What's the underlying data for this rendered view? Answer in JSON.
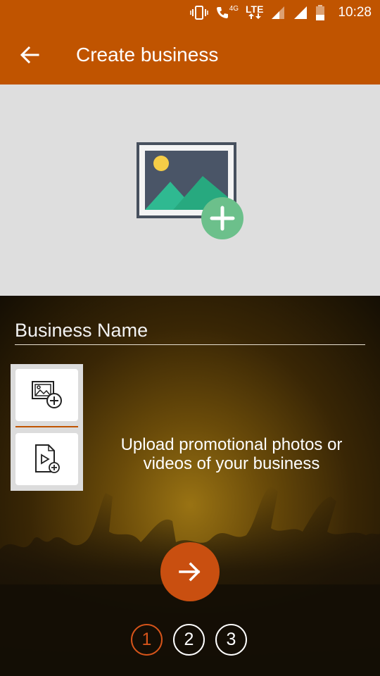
{
  "status_bar": {
    "network_type": "4G",
    "lte_label": "LTE",
    "time": "10:28"
  },
  "app_bar": {
    "title": "Create business",
    "back_icon": "arrow-back-icon"
  },
  "cover": {
    "icon": "add-image-icon"
  },
  "form": {
    "business_name_placeholder": "Business Name"
  },
  "media": {
    "photo_icon": "add-photo-icon",
    "video_icon": "add-video-icon",
    "upload_text": "Upload promotional photos or videos of your business"
  },
  "next": {
    "icon": "arrow-forward-icon"
  },
  "steps": [
    "1",
    "2",
    "3"
  ],
  "colors": {
    "brand": "#c05400",
    "accent_button": "#c94f10",
    "active_step": "#d6541a",
    "cover_bg": "#dedede",
    "add_badge": "#6cc08b"
  }
}
